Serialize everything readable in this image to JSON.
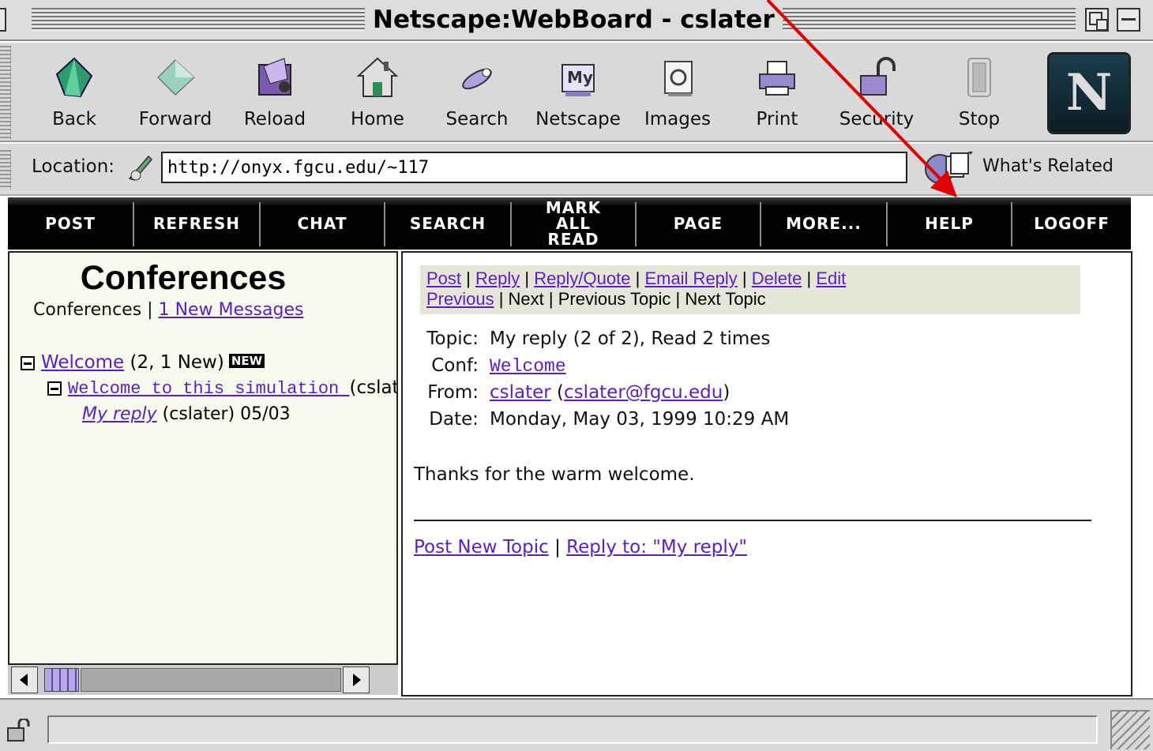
{
  "window": {
    "title": "Netscape:WebBoard - cslater"
  },
  "toolbar": {
    "buttons": [
      {
        "label": "Back",
        "icon": "back-icon"
      },
      {
        "label": "Forward",
        "icon": "forward-icon"
      },
      {
        "label": "Reload",
        "icon": "reload-icon"
      },
      {
        "label": "Home",
        "icon": "home-icon"
      },
      {
        "label": "Search",
        "icon": "search-icon"
      },
      {
        "label": "Netscape",
        "icon": "my-netscape-icon"
      },
      {
        "label": "Images",
        "icon": "images-icon"
      },
      {
        "label": "Print",
        "icon": "print-icon"
      },
      {
        "label": "Security",
        "icon": "security-lock-icon"
      },
      {
        "label": "Stop",
        "icon": "stop-icon"
      }
    ],
    "my_icon_text": "My",
    "logo_letter": "N"
  },
  "location": {
    "label": "Location:",
    "url": "http://onyx.fgcu.edu/~117",
    "related_label": "What's Related"
  },
  "nav": {
    "items": [
      "POST",
      "REFRESH",
      "CHAT",
      "SEARCH",
      "MARK ALL READ",
      "PAGE",
      "MORE...",
      "HELP",
      "LOGOFF"
    ]
  },
  "left": {
    "heading": "Conferences",
    "sub_label": "Conferences",
    "sub_sep": " | ",
    "new_messages_link": "1 New Messages",
    "tree": {
      "conference_link": "Welcome",
      "conference_counts": " (2, 1 New)",
      "new_badge": "NEW",
      "topic_link": "Welcome to this simulation ",
      "topic_author": "(cslat",
      "reply_link": "My reply",
      "reply_meta": " (cslater) 05/03"
    }
  },
  "message": {
    "actions_row1": {
      "post": "Post",
      "reply": "Reply",
      "reply_quote": "Reply/Quote",
      "email_reply": "Email Reply",
      "delete": "Delete",
      "edit": "Edit"
    },
    "actions_row2": {
      "previous": "Previous",
      "next": "Next",
      "previous_topic": "Previous Topic",
      "next_topic": "Next Topic"
    },
    "sep": " | ",
    "topic_key": "Topic:",
    "topic_value": "My reply (2 of 2), Read 2 times",
    "conf_key": "Conf:",
    "conf_value": "Welcome",
    "from_key": "From:",
    "from_name": "cslater",
    "from_email": "cslater@fgcu.edu",
    "date_key": "Date:",
    "date_value": "Monday, May 03, 1999 10:29 AM",
    "body": "Thanks for the warm welcome.",
    "footer_post_new": "Post New Topic",
    "footer_reply_to": "Reply to: \"My reply\""
  },
  "colors": {
    "link": "#5a1ec8",
    "nav_bg": "#000000",
    "left_frame_bg": "#f7fbee",
    "annotation_arrow": "#e00000"
  }
}
